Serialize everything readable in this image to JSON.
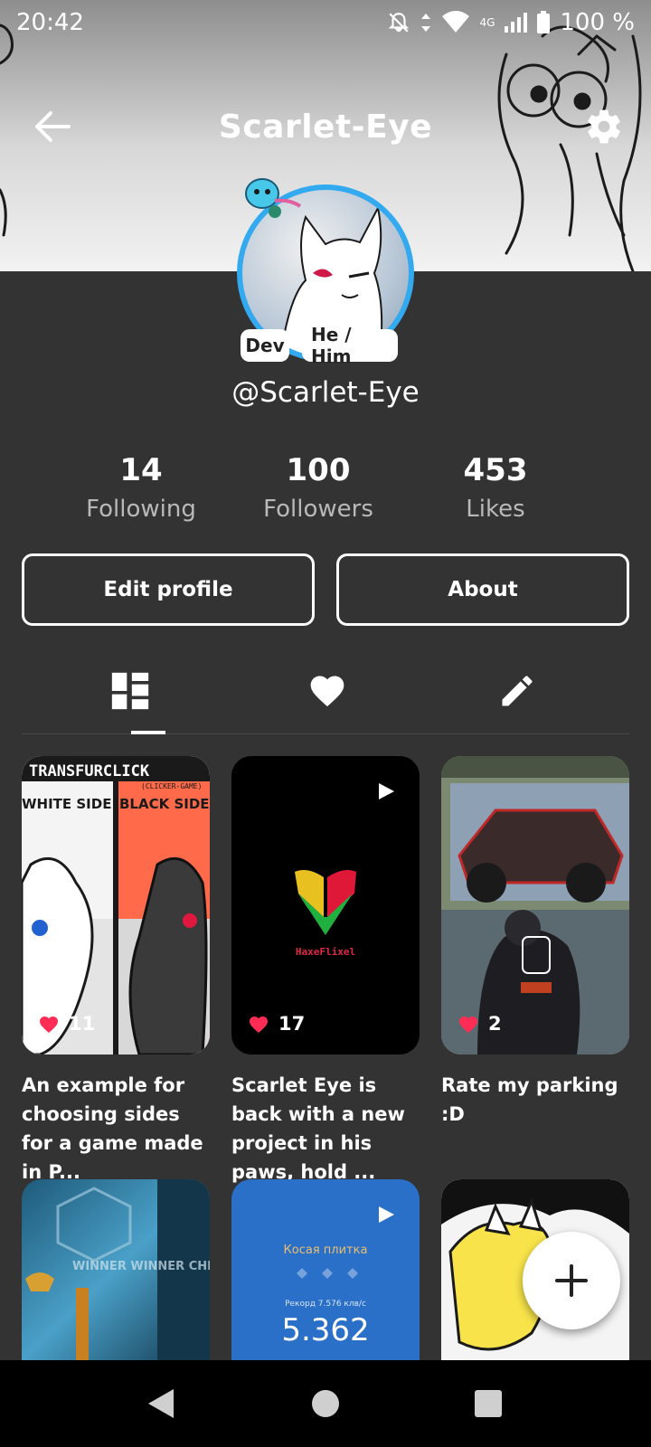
{
  "status": {
    "time": "20:42",
    "network": "4G",
    "battery": "100 %"
  },
  "header": {
    "title": "Scarlet-Eye"
  },
  "profile": {
    "handle": "@Scarlet-Eye",
    "badges": [
      "Dev",
      "He / Him"
    ],
    "ring_color": "#33aaf0"
  },
  "stats": [
    {
      "value": "14",
      "label": "Following"
    },
    {
      "value": "100",
      "label": "Followers"
    },
    {
      "value": "453",
      "label": "Likes"
    }
  ],
  "actions": {
    "edit": "Edit profile",
    "about": "About"
  },
  "tabs": [
    {
      "icon": "grid-icon",
      "selected": true
    },
    {
      "icon": "heart-icon",
      "selected": false
    },
    {
      "icon": "pencil-icon",
      "selected": false
    }
  ],
  "posts": [
    {
      "likes": "11",
      "caption": "An example for choosing sides for a game made in P...",
      "thumb_text_1": "TRANSFURCLICK",
      "thumb_text_2": "(CLICKER-GAME)",
      "thumb_text_3": "WHITE SIDE",
      "thumb_text_4": "BLACK SIDE"
    },
    {
      "likes": "17",
      "caption": "Scarlet Eye is back with a new project in his paws, hold ...",
      "thumb_text_1": "HaxeFlixel"
    },
    {
      "likes": "2",
      "caption": "Rate my parking :D"
    },
    {
      "thumb_text_1": "WINNER WINNER CHICKEN DINNER"
    },
    {
      "thumb_text_1": "Косая плитка",
      "thumb_text_2": "Рекорд 7.576 клв/с",
      "thumb_text_3": "5.362"
    },
    {}
  ],
  "colors": {
    "background": "#333333",
    "heart": "#ff2d55",
    "accent": "#33aaf0"
  }
}
